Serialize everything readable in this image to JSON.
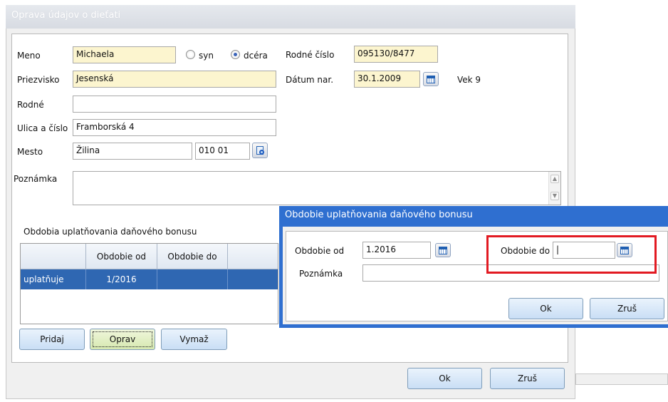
{
  "main_window": {
    "title": "Oprava údajov o dieťati",
    "labels": {
      "meno": "Meno",
      "priezvisko": "Priezvisko",
      "rodne": "Rodné",
      "ulica": "Ulica a číslo",
      "mesto": "Mesto",
      "poznamka": "Poznámka",
      "rodne_cislo": "Rodné číslo",
      "datum_nar": "Dátum nar."
    },
    "fields": {
      "meno": "Michaela",
      "priezvisko": "Jesenská",
      "rodne": "",
      "ulica": "Framborská 4",
      "mesto": "Žilina",
      "psc": "010 01",
      "poznamka": "",
      "rodne_cislo": "095130/8477",
      "datum_nar": "30.1.2009"
    },
    "gender": {
      "syn": "syn",
      "dcera": "dcéra",
      "selected": "dcéra"
    },
    "age_label": "Vek 9",
    "bonus_section_title": "Obdobia uplatňovania daňového bonusu",
    "grid": {
      "columns": [
        "",
        "Obdobie od",
        "Obdobie do"
      ],
      "rows": [
        {
          "status": "uplatňuje",
          "od": "1/2016",
          "do": ""
        }
      ]
    },
    "grid_buttons": {
      "add": "Pridaj",
      "edit": "Oprav",
      "delete": "Vymaž"
    },
    "ok": "Ok",
    "cancel": "Zruš"
  },
  "dialog": {
    "title": "Obdobie uplatňovania daňového bonusu",
    "labels": {
      "od": "Obdobie od",
      "do": "Obdobie do",
      "poznamka": "Poznámka"
    },
    "fields": {
      "od": "1.2016",
      "do": "|",
      "poznamka": ""
    },
    "ok": "Ok",
    "cancel": "Zruš"
  },
  "colors": {
    "dialog_frame": "#2f6fd0",
    "selection": "#2f67b2",
    "required_field": "#fcf5cf",
    "highlight": "#e21a22"
  }
}
